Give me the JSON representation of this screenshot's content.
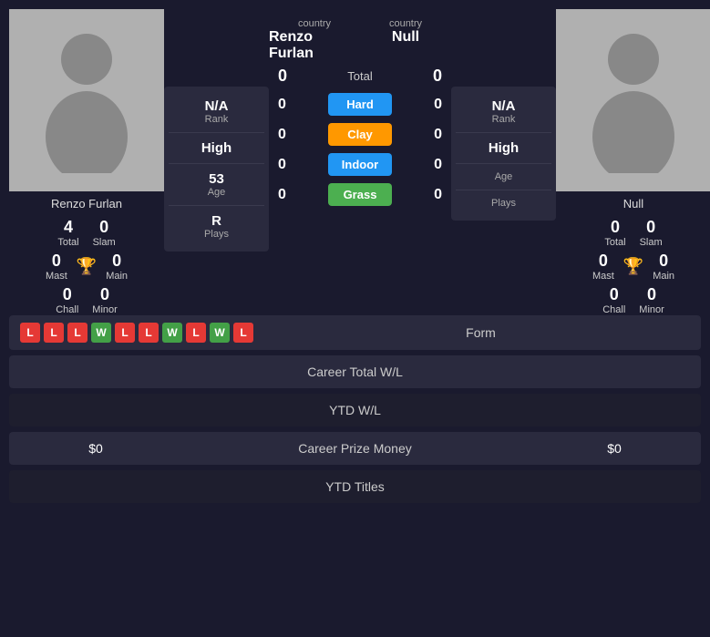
{
  "players": {
    "left": {
      "name": "Renzo Furlan",
      "country": "country",
      "rank": "N/A",
      "rank_label": "Rank",
      "high": "High",
      "high_label": "",
      "age": "53",
      "age_label": "Age",
      "plays": "R",
      "plays_label": "Plays",
      "total": "4",
      "total_label": "Total",
      "slam": "0",
      "slam_label": "Slam",
      "mast": "0",
      "mast_label": "Mast",
      "main": "0",
      "main_label": "Main",
      "chall": "0",
      "chall_label": "Chall",
      "minor": "0",
      "minor_label": "Minor"
    },
    "right": {
      "name": "Null",
      "country": "country",
      "rank": "N/A",
      "rank_label": "Rank",
      "high": "High",
      "high_label": "",
      "age": "",
      "age_label": "Age",
      "plays": "",
      "plays_label": "Plays",
      "total": "0",
      "total_label": "Total",
      "slam": "0",
      "slam_label": "Slam",
      "mast": "0",
      "mast_label": "Mast",
      "main": "0",
      "main_label": "Main",
      "chall": "0",
      "chall_label": "Chall",
      "minor": "0",
      "minor_label": "Minor"
    }
  },
  "surfaces": {
    "total": {
      "label": "Total",
      "left": "0",
      "right": "0"
    },
    "hard": {
      "label": "Hard",
      "left": "0",
      "right": "0",
      "class": "btn-hard"
    },
    "clay": {
      "label": "Clay",
      "left": "0",
      "right": "0",
      "class": "btn-clay"
    },
    "indoor": {
      "label": "Indoor",
      "left": "0",
      "right": "0",
      "class": "btn-indoor"
    },
    "grass": {
      "label": "Grass",
      "left": "0",
      "right": "0",
      "class": "btn-grass"
    }
  },
  "form": {
    "label": "Form",
    "badges": [
      "L",
      "L",
      "L",
      "W",
      "L",
      "L",
      "W",
      "L",
      "W",
      "L"
    ]
  },
  "stats_rows": [
    {
      "label": "Career Total W/L",
      "left": "",
      "right": "",
      "alt": false
    },
    {
      "label": "YTD W/L",
      "left": "",
      "right": "",
      "alt": true
    },
    {
      "label": "Career Prize Money",
      "left": "$0",
      "right": "$0",
      "alt": false
    },
    {
      "label": "YTD Titles",
      "left": "",
      "right": "",
      "alt": true
    }
  ]
}
